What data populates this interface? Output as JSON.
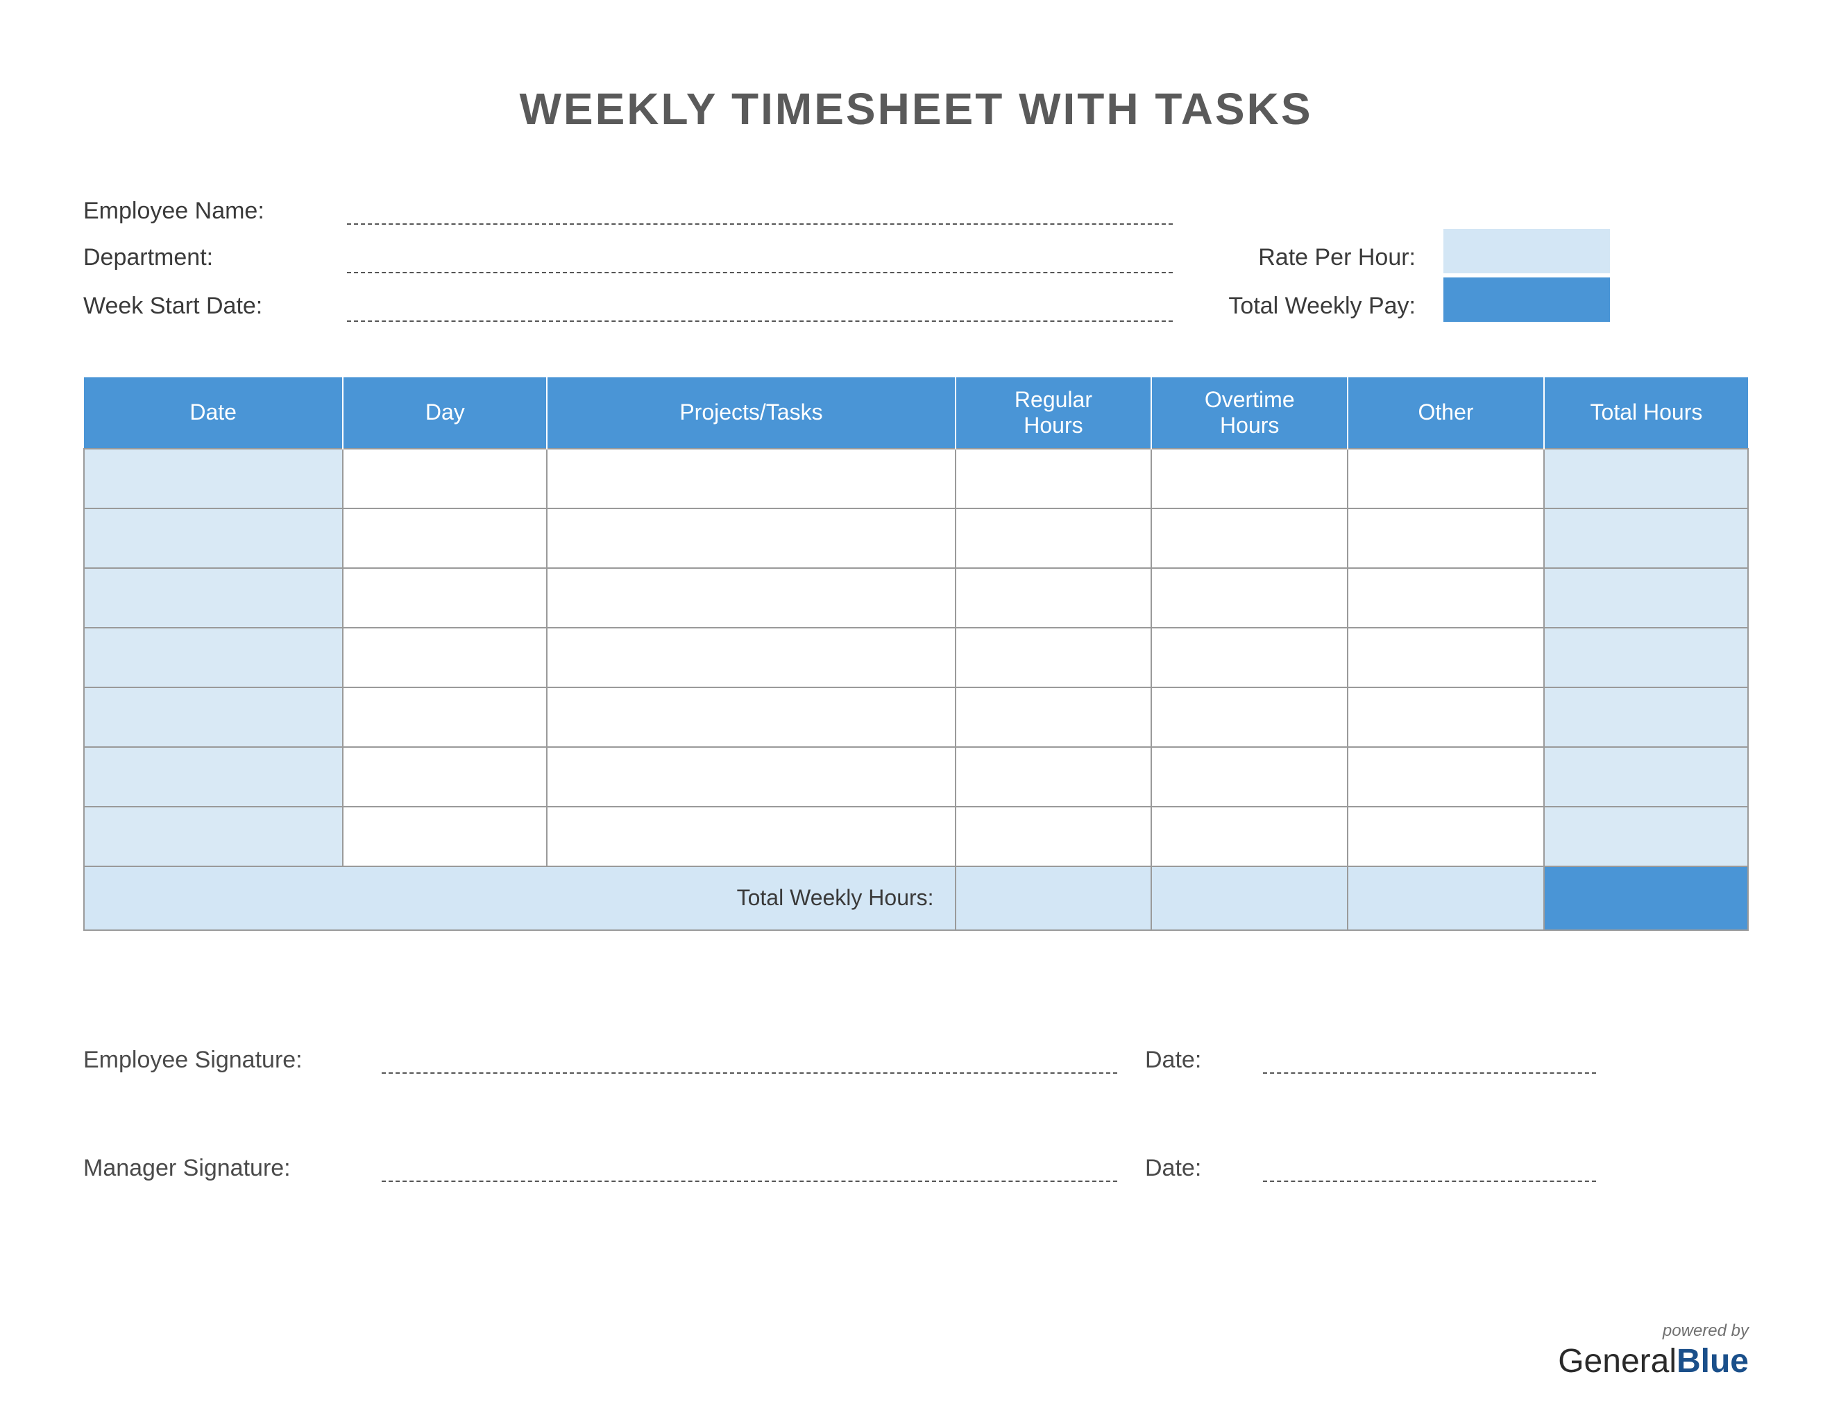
{
  "title": "WEEKLY TIMESHEET WITH TASKS",
  "labels": {
    "employee_name": "Employee Name:",
    "department": "Department:",
    "week_start": "Week Start Date:",
    "rate_per_hour": "Rate Per Hour:",
    "total_weekly_pay": "Total Weekly Pay:",
    "total_weekly_hours": "Total Weekly Hours:",
    "employee_signature": "Employee Signature:",
    "manager_signature": "Manager Signature:",
    "date": "Date:"
  },
  "columns": {
    "date": "Date",
    "day": "Day",
    "projects": "Projects/Tasks",
    "regular": "Regular\nHours",
    "overtime": "Overtime\nHours",
    "other": "Other",
    "total": "Total Hours"
  },
  "values": {
    "employee_name": "",
    "department": "",
    "week_start": "",
    "rate_per_hour": "",
    "total_weekly_pay": "",
    "weekly_totals": {
      "regular": "",
      "overtime": "",
      "other": "",
      "total": ""
    }
  },
  "rows": [
    {
      "date": "",
      "day": "",
      "projects": "",
      "regular": "",
      "overtime": "",
      "other": "",
      "total": ""
    },
    {
      "date": "",
      "day": "",
      "projects": "",
      "regular": "",
      "overtime": "",
      "other": "",
      "total": ""
    },
    {
      "date": "",
      "day": "",
      "projects": "",
      "regular": "",
      "overtime": "",
      "other": "",
      "total": ""
    },
    {
      "date": "",
      "day": "",
      "projects": "",
      "regular": "",
      "overtime": "",
      "other": "",
      "total": ""
    },
    {
      "date": "",
      "day": "",
      "projects": "",
      "regular": "",
      "overtime": "",
      "other": "",
      "total": ""
    },
    {
      "date": "",
      "day": "",
      "projects": "",
      "regular": "",
      "overtime": "",
      "other": "",
      "total": ""
    },
    {
      "date": "",
      "day": "",
      "projects": "",
      "regular": "",
      "overtime": "",
      "other": "",
      "total": ""
    }
  ],
  "footer": {
    "powered": "powered by",
    "brand_general": "General",
    "brand_blue": "Blue"
  }
}
